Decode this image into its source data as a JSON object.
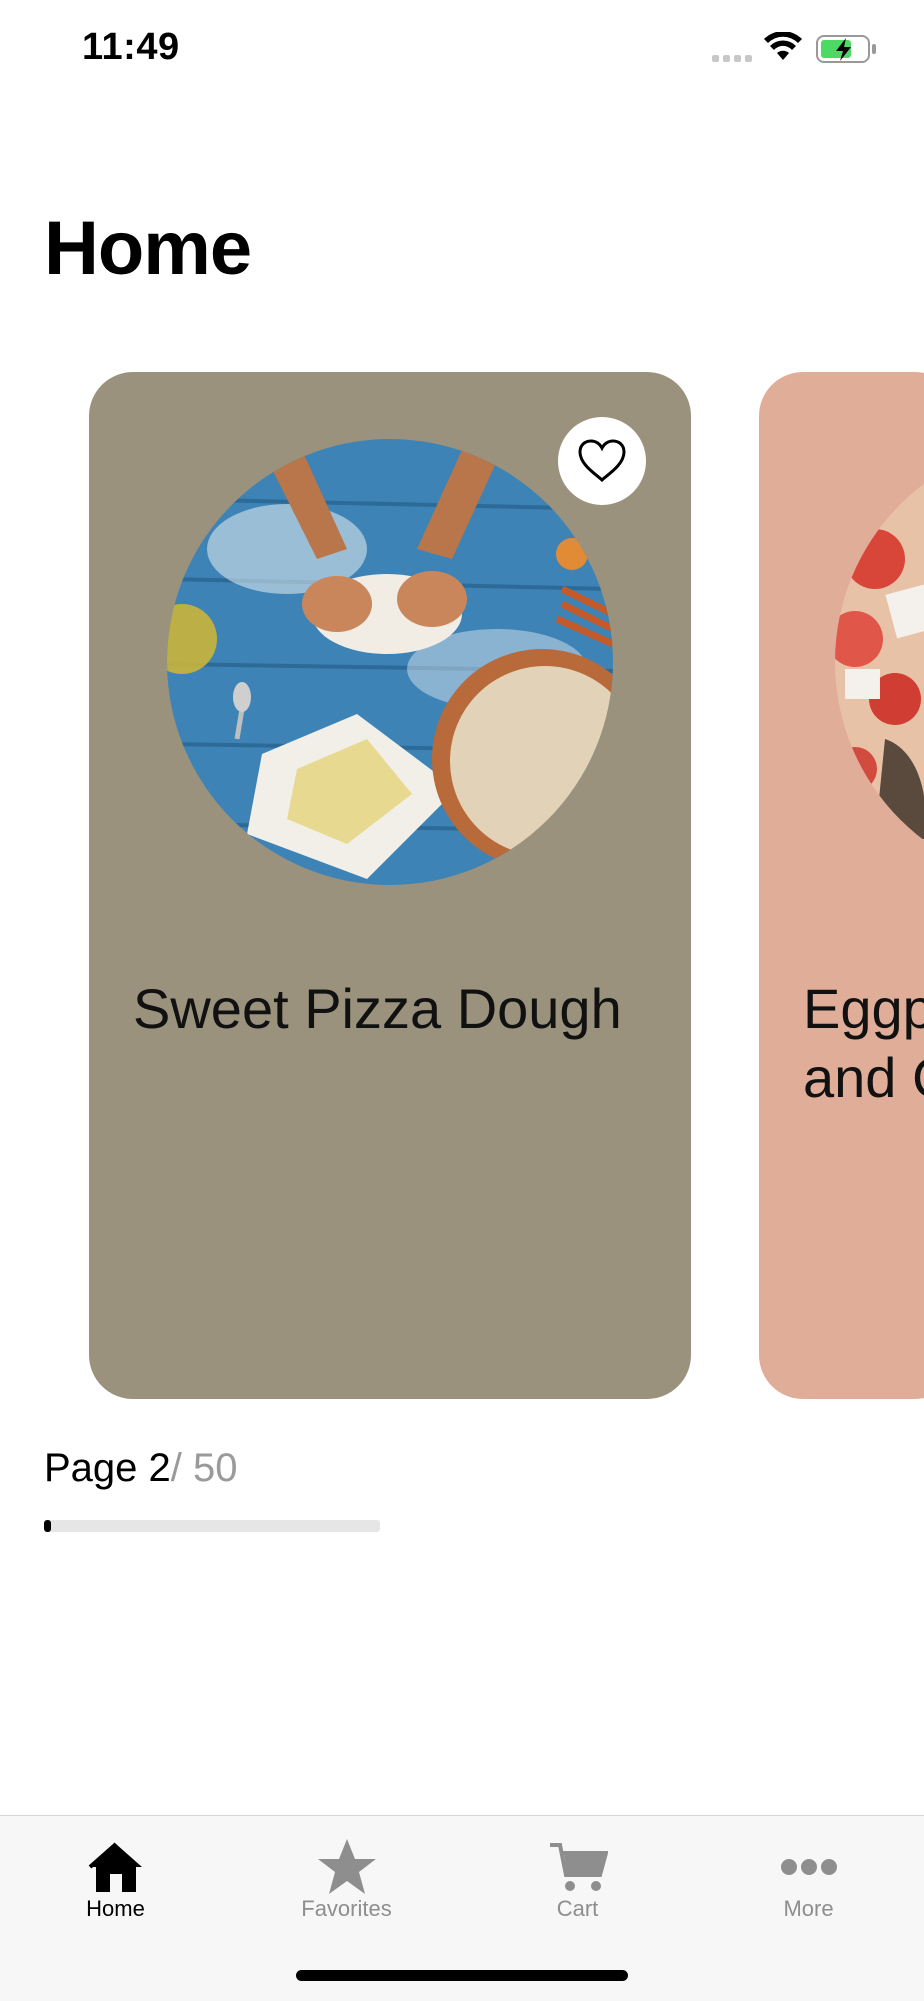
{
  "status_bar": {
    "time": "11:49"
  },
  "header": {
    "title": "Home"
  },
  "cards": [
    {
      "title": "Sweet Pizza Dough",
      "favorite_icon": "heart-outline-icon",
      "image": "pizza-dough-photo"
    },
    {
      "title": "Eggplant\nand C",
      "image": "pizza-photo"
    }
  ],
  "pagination": {
    "current": "Page 2",
    "total": "/ 50",
    "progress": 0.02
  },
  "tabs": [
    {
      "label": "Home",
      "icon": "house-icon",
      "active": true
    },
    {
      "label": "Favorites",
      "icon": "star-icon",
      "active": false
    },
    {
      "label": "Cart",
      "icon": "cart-icon",
      "active": false
    },
    {
      "label": "More",
      "icon": "ellipsis-icon",
      "active": false
    }
  ],
  "colors": {
    "card_1_bg": "#9a927d",
    "card_2_bg": "#e0ad98",
    "tab_inactive": "#8e8e8e"
  }
}
